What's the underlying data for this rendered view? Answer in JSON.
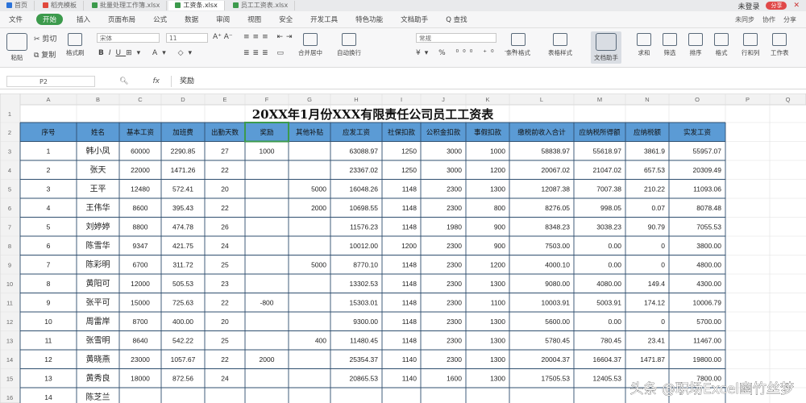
{
  "tabs": [
    {
      "label": "首页",
      "active": false,
      "icon_color": "#2a72d9"
    },
    {
      "label": "稻壳模板",
      "active": false,
      "icon_color": "#e0483c"
    },
    {
      "label": "批量处理工作簿.xlsx",
      "active": false,
      "icon_color": "#3c9a4c"
    },
    {
      "label": "工资条.xlsx",
      "active": true,
      "icon_color": "#3c9a4c"
    },
    {
      "label": "员工工资表.xlsx",
      "active": false,
      "icon_color": "#3c9a4c"
    }
  ],
  "tabs_right": {
    "user": "未登录",
    "share": "分享"
  },
  "menu": [
    "文件",
    "开始",
    "插入",
    "页面布局",
    "公式",
    "数据",
    "审阅",
    "视图",
    "安全",
    "开发工具",
    "特色功能",
    "文档助手",
    "Q 查找"
  ],
  "menu_active": "开始",
  "menu_right": [
    "未同步",
    "协作",
    "分享"
  ],
  "ribbon": {
    "paste": "粘贴",
    "cut": "剪切",
    "copy": "复制",
    "format_painter": "格式刷",
    "font_name": "宋体",
    "font_size": "11",
    "merge": "合并居中",
    "wrap": "自动换行",
    "number_format": "常规",
    "cond_format": "条件格式",
    "table_style": "表格样式",
    "doc_assist": "文档助手",
    "sum": "求和",
    "filter": "筛选",
    "sort": "排序",
    "format": "格式",
    "fill": "行和列",
    "worksheet": "工作表"
  },
  "formula": {
    "cell": "P2",
    "fx": "fx",
    "value": "奖励"
  },
  "columns": [
    "A",
    "B",
    "C",
    "D",
    "E",
    "F",
    "G",
    "H",
    "I",
    "J",
    "K",
    "L",
    "M",
    "N",
    "O",
    "P",
    "Q"
  ],
  "rows": [
    "1",
    "2",
    "3",
    "4",
    "5",
    "6",
    "7",
    "8",
    "9",
    "10",
    "11",
    "12",
    "13",
    "14",
    "15",
    "16"
  ],
  "title": "20XX年1月份XXX有限责任公司员工工资表",
  "headers": [
    "序号",
    "姓名",
    "基本工资",
    "加班费",
    "出勤天数",
    "奖励",
    "其他补贴",
    "应发工资",
    "社保扣款",
    "公积金扣款",
    "事假扣款",
    "缴税前收入合计",
    "应纳税所得额",
    "应纳税额",
    "实发工资"
  ],
  "data": [
    [
      "1",
      "韩小凤",
      "60000",
      "2290.85",
      "27",
      "1000",
      "",
      "63088.97",
      "1250",
      "3000",
      "1000",
      "58838.97",
      "55618.97",
      "3861.9",
      "55957.07"
    ],
    [
      "2",
      "张天",
      "22000",
      "1471.26",
      "22",
      "",
      "",
      "23367.02",
      "1250",
      "3000",
      "1200",
      "20067.02",
      "21047.02",
      "657.53",
      "20309.49"
    ],
    [
      "3",
      "王平",
      "12480",
      "572.41",
      "20",
      "",
      "5000",
      "16048.26",
      "1148",
      "2300",
      "1300",
      "12087.38",
      "7007.38",
      "210.22",
      "11093.06"
    ],
    [
      "4",
      "王伟华",
      "8600",
      "395.43",
      "22",
      "",
      "2000",
      "10698.55",
      "1148",
      "2300",
      "800",
      "8276.05",
      "998.05",
      "0.07",
      "8078.48"
    ],
    [
      "5",
      "刘婷婷",
      "8800",
      "474.78",
      "26",
      "",
      "",
      "11576.23",
      "1148",
      "1980",
      "900",
      "8348.23",
      "3038.23",
      "90.79",
      "7055.53"
    ],
    [
      "6",
      "陈雪华",
      "9347",
      "421.75",
      "24",
      "",
      "",
      "10012.00",
      "1200",
      "2300",
      "900",
      "7503.00",
      "0.00",
      "0",
      "3800.00"
    ],
    [
      "7",
      "陈彩明",
      "6700",
      "311.72",
      "25",
      "",
      "5000",
      "8770.10",
      "1148",
      "2300",
      "1200",
      "4000.10",
      "0.00",
      "0",
      "4800.00"
    ],
    [
      "8",
      "黄阳可",
      "12000",
      "505.53",
      "23",
      "",
      "",
      "13302.53",
      "1148",
      "2300",
      "1300",
      "9080.00",
      "4080.00",
      "149.4",
      "4300.00"
    ],
    [
      "9",
      "张平可",
      "15000",
      "725.63",
      "22",
      "-800",
      "",
      "15303.01",
      "1148",
      "2300",
      "1100",
      "10003.91",
      "5003.91",
      "174.12",
      "10006.79"
    ],
    [
      "10",
      "周雷岸",
      "8700",
      "400.00",
      "20",
      "",
      "",
      "9300.00",
      "1148",
      "2300",
      "1300",
      "5600.00",
      "0.00",
      "0",
      "5700.00"
    ],
    [
      "11",
      "张雪明",
      "8640",
      "542.22",
      "25",
      "",
      "400",
      "11480.45",
      "1148",
      "2300",
      "1300",
      "5780.45",
      "780.45",
      "23.41",
      "11467.00"
    ],
    [
      "12",
      "黄晓燕",
      "23000",
      "1057.67",
      "22",
      "2000",
      "",
      "25354.37",
      "1140",
      "2300",
      "1300",
      "20004.37",
      "16604.37",
      "1471.87",
      "19800.00"
    ],
    [
      "13",
      "黄秀良",
      "18000",
      "872.56",
      "24",
      "",
      "",
      "20865.53",
      "1140",
      "1600",
      "1300",
      "17505.53",
      "12405.53",
      "",
      "7800.00"
    ],
    [
      "14",
      "陈芝兰",
      "",
      "",
      "",
      "",
      "",
      "",
      "",
      "",
      "",
      "",
      "",
      "",
      ""
    ]
  ],
  "watermark": "头条 @职场Excel幽竹丝梦",
  "colors": {
    "header_fill": "#5b9bd5",
    "active_green": "#3c9a4c",
    "grid": "#d4d4d4",
    "table_border": "#2f4f6f"
  }
}
